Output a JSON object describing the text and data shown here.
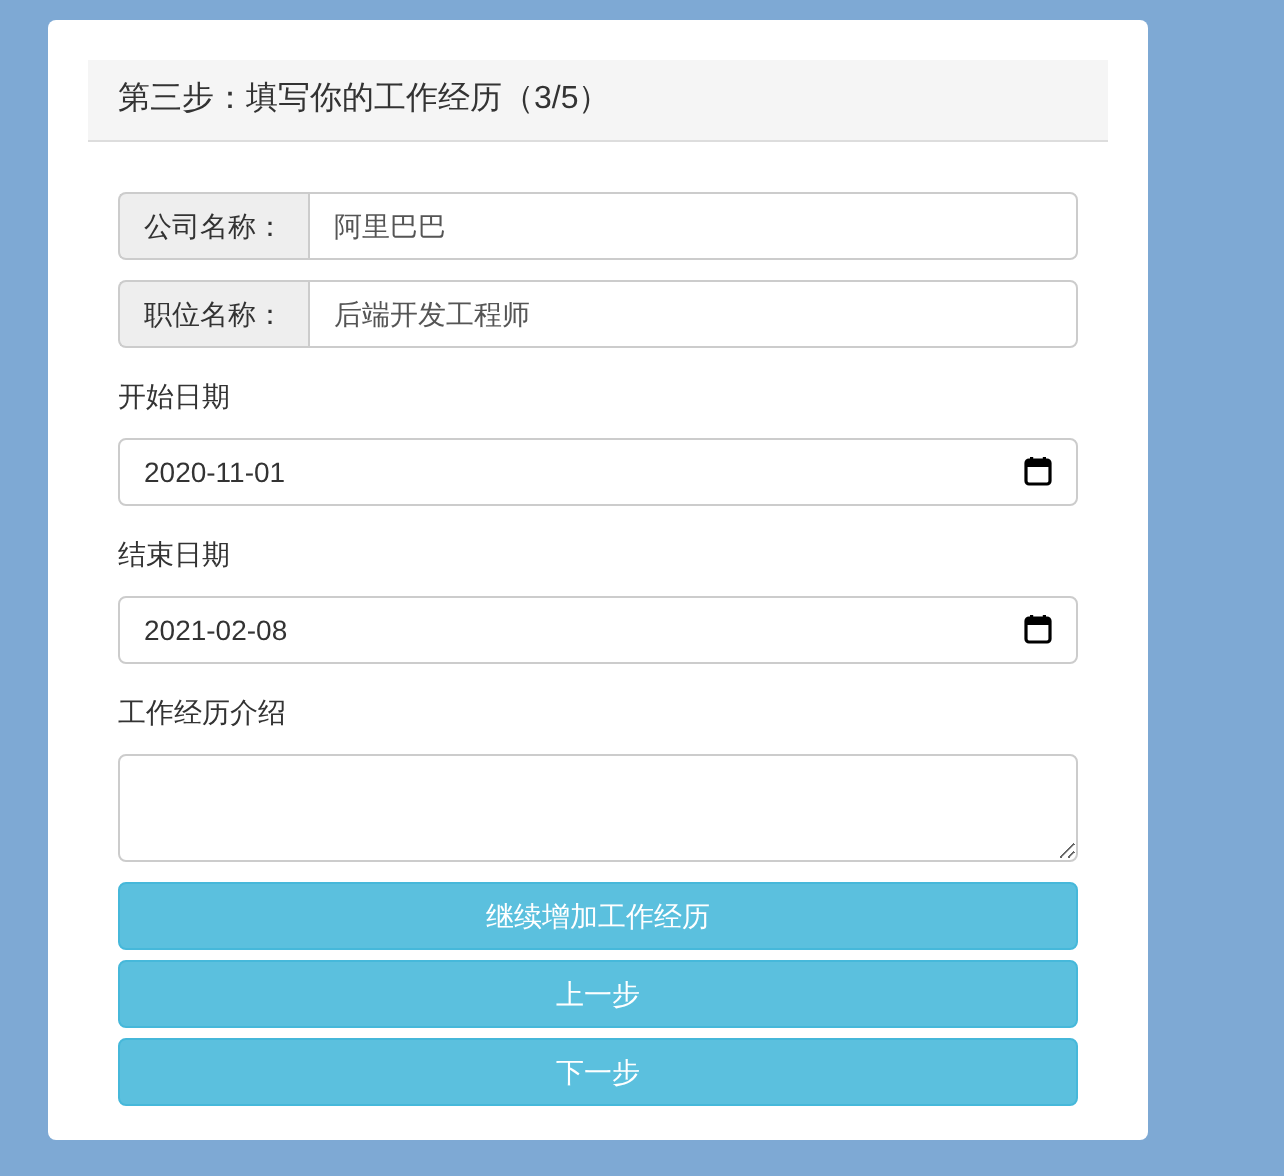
{
  "header": {
    "title": "第三步：填写你的工作经历（3/5）"
  },
  "fields": [
    {
      "kind": "addon",
      "label": "公司名称：",
      "value": "阿里巴巴"
    },
    {
      "kind": "addon",
      "label": "职位名称：",
      "value": "后端开发工程师"
    },
    {
      "kind": "date",
      "label": "开始日期",
      "value": "2020-11-01"
    },
    {
      "kind": "date",
      "label": "结束日期",
      "value": "2021-02-08"
    },
    {
      "kind": "textarea",
      "label": "工作经历介绍"
    }
  ],
  "buttons": [
    "继续增加工作经历",
    "上一步",
    "下一步"
  ]
}
